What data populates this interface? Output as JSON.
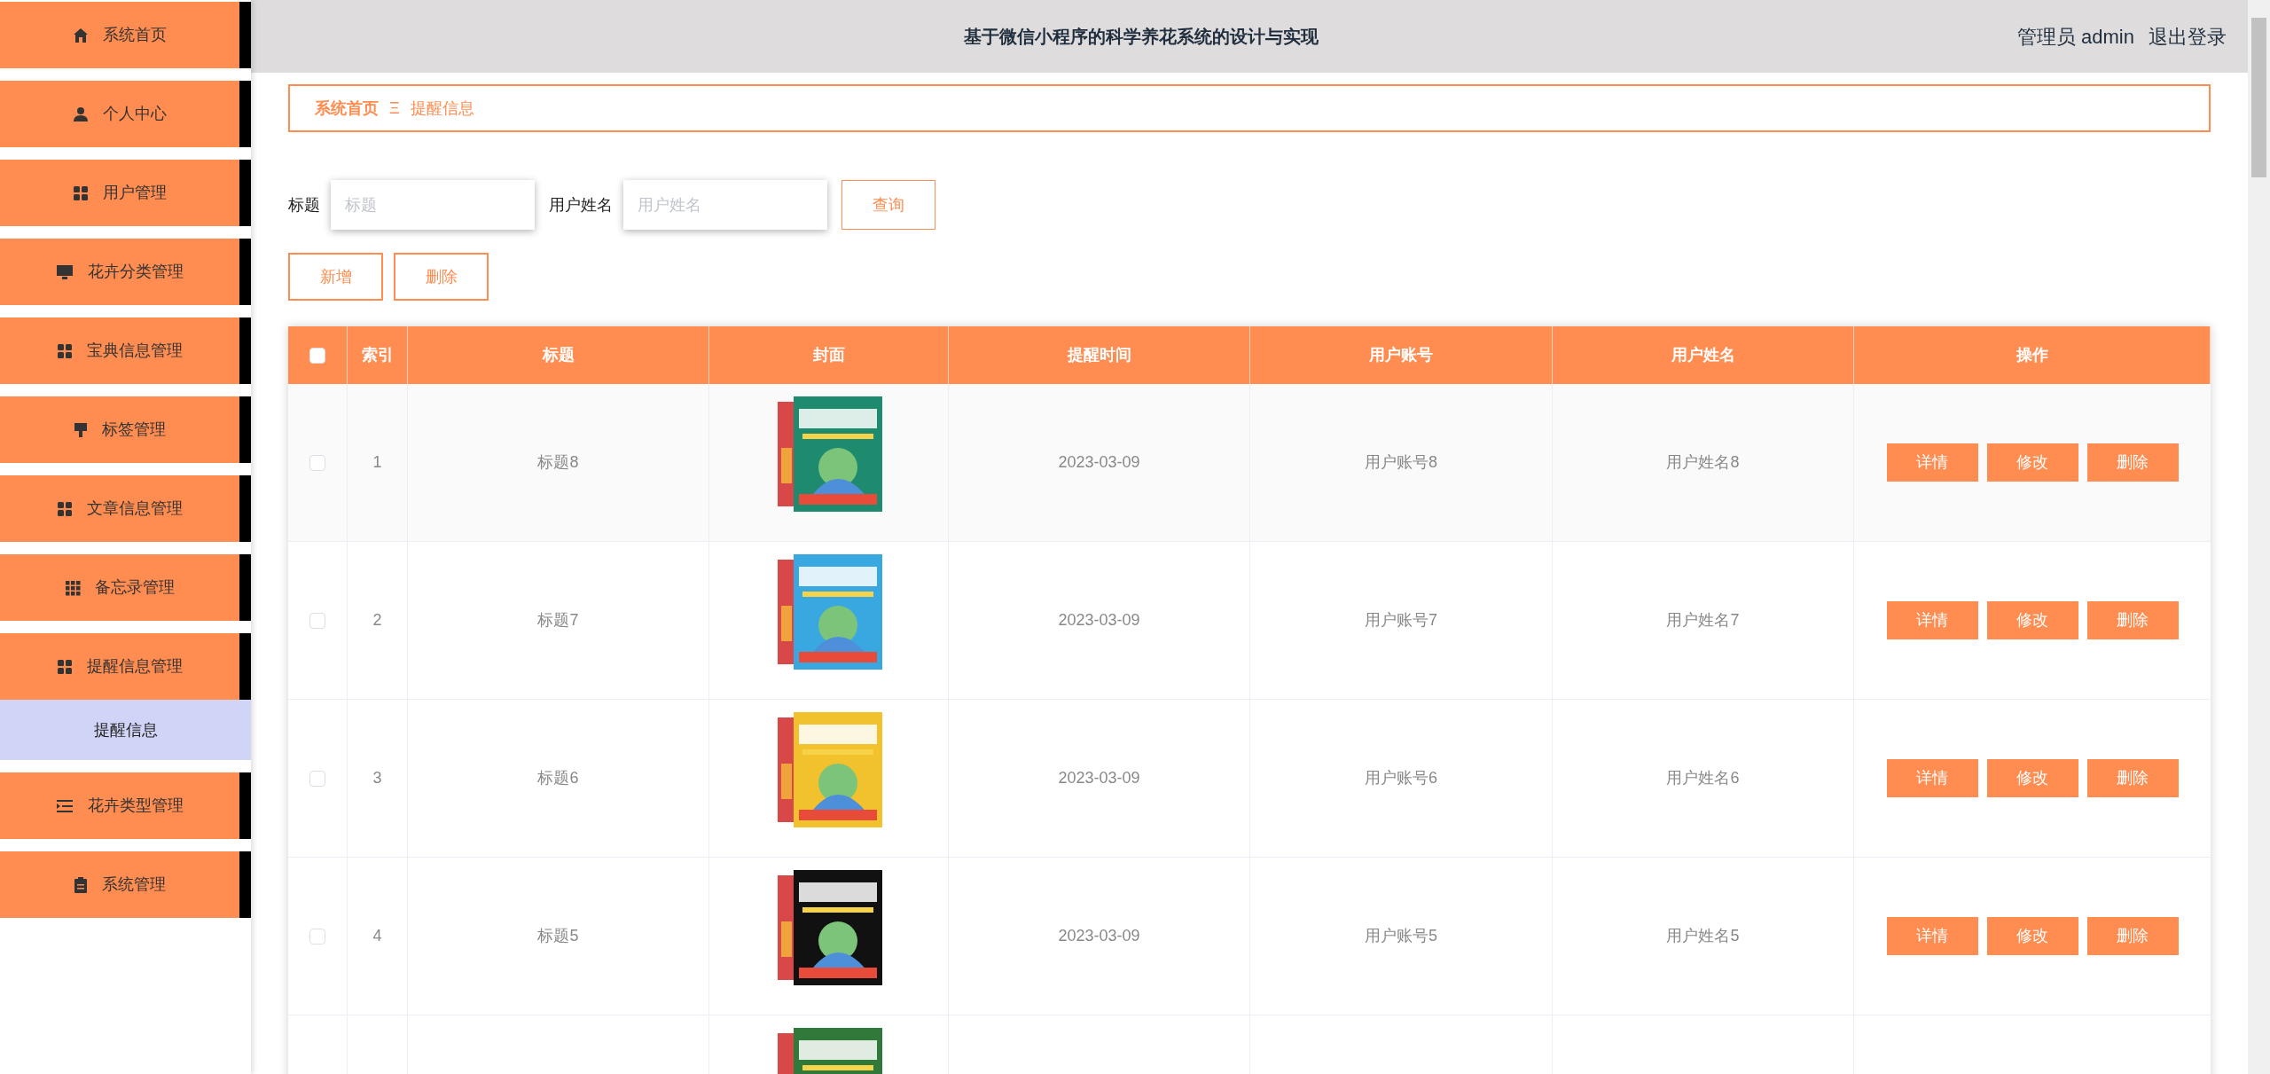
{
  "sidebar": {
    "items": [
      {
        "label": "系统首页",
        "selected": false
      },
      {
        "label": "个人中心",
        "selected": false
      },
      {
        "label": "用户管理",
        "selected": false
      },
      {
        "label": "花卉分类管理",
        "selected": false
      },
      {
        "label": "宝典信息管理",
        "selected": false
      },
      {
        "label": "标签管理",
        "selected": false
      },
      {
        "label": "文章信息管理",
        "selected": false
      },
      {
        "label": "备忘录管理",
        "selected": false
      },
      {
        "label": "提醒信息管理",
        "selected": false,
        "children": [
          {
            "label": "提醒信息",
            "selected": true
          }
        ]
      },
      {
        "label": "花卉类型管理",
        "selected": false
      },
      {
        "label": "系统管理",
        "selected": false
      }
    ]
  },
  "header": {
    "title": "基于微信小程序的科学养花系统的设计与实现",
    "user": "管理员 admin",
    "logout": "退出登录"
  },
  "breadcrumb": {
    "home": "系统首页",
    "separator": "Ξ",
    "current": "提醒信息"
  },
  "search": {
    "fields": [
      {
        "label": "标题",
        "placeholder": "标题"
      },
      {
        "label": "用户姓名",
        "placeholder": "用户姓名"
      }
    ],
    "button": "查询"
  },
  "actions": [
    "新增",
    "删除"
  ],
  "table": {
    "columns": [
      "索引",
      "标题",
      "封面",
      "提醒时间",
      "用户账号",
      "用户姓名",
      "操作"
    ],
    "select_all": {
      "checked": false
    },
    "rows": [
      {
        "kind": "full",
        "checked": false,
        "index": "1",
        "title": "标题8",
        "time": "2023-03-09",
        "account": "用户账号8",
        "name": "用户姓名8",
        "buttons": [
          "详情",
          "修改",
          "删除"
        ]
      },
      {
        "kind": "full",
        "checked": false,
        "index": "2",
        "title": "标题7",
        "time": "2023-03-09",
        "account": "用户账号7",
        "name": "用户姓名7",
        "buttons": [
          "详情",
          "修改",
          "删除"
        ]
      },
      {
        "kind": "full",
        "checked": false,
        "index": "3",
        "title": "标题6",
        "time": "2023-03-09",
        "account": "用户账号6",
        "name": "用户姓名6",
        "buttons": [
          "详情",
          "修改",
          "删除"
        ]
      },
      {
        "kind": "full",
        "checked": false,
        "index": "4",
        "title": "标题5",
        "time": "2023-03-09",
        "account": "用户账号5",
        "name": "用户姓名5",
        "buttons": [
          "详情",
          "修改",
          "删除"
        ]
      },
      {
        "kind": "cut"
      }
    ]
  }
}
